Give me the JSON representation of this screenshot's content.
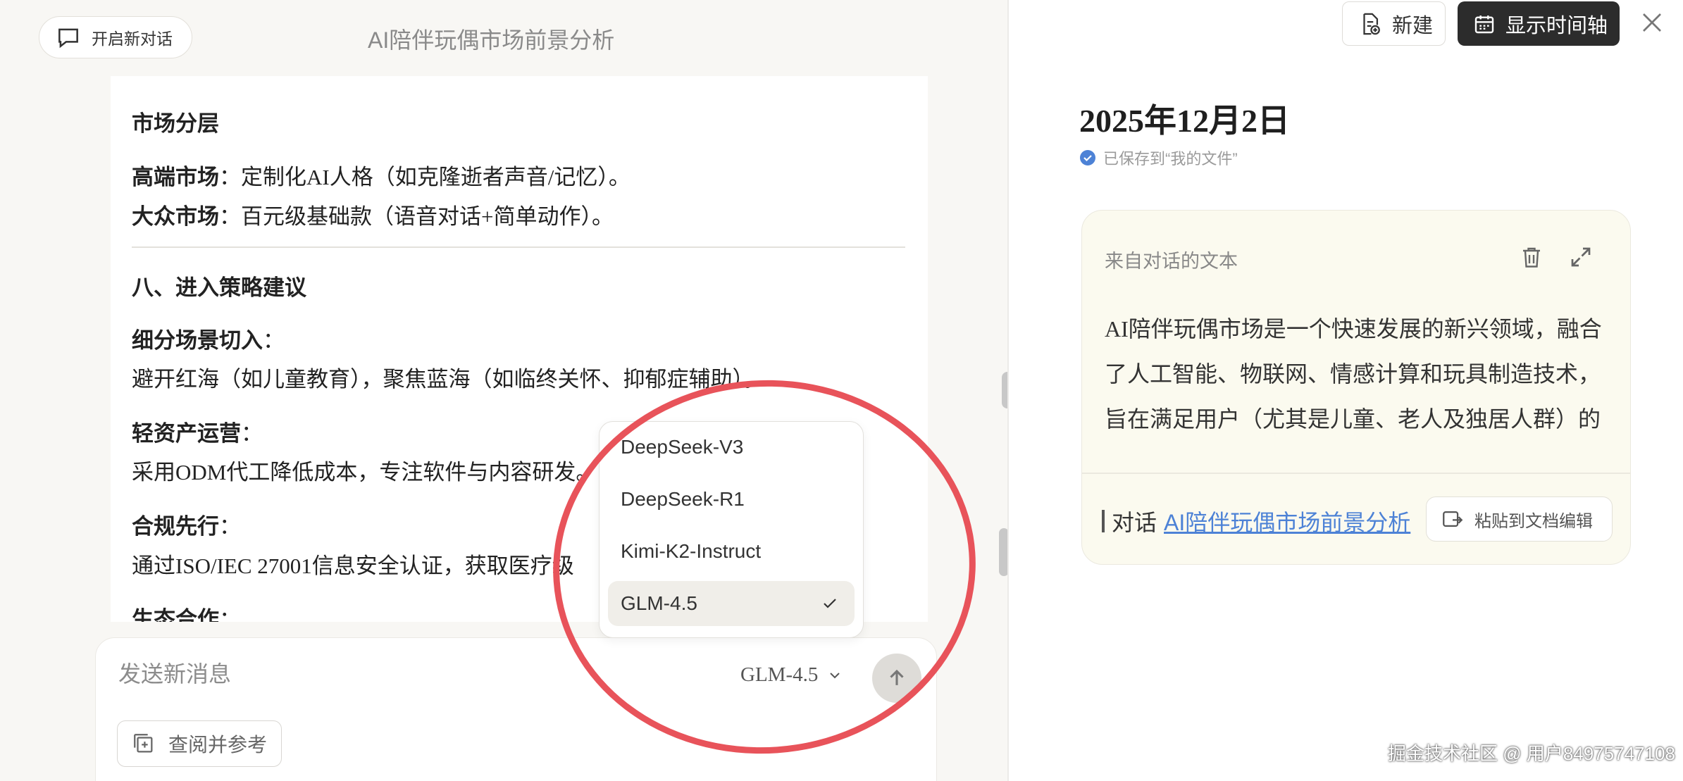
{
  "header": {
    "new_chat_label": "开启新对话",
    "conversation_title": "AI陪伴玩偶市场前景分析"
  },
  "document": {
    "section_market_layers": "市场分层",
    "high_end_label": "高端市场",
    "high_end_text": "：定制化AI人格（如克隆逝者声音/记忆）。",
    "mass_label": "大众市场",
    "mass_text": "：百元级基础款（语音对话+简单动作）。",
    "section_strategy": "八、进入策略建议",
    "item1_title": "细分场景切入",
    "item1_text": "避开红海（如儿童教育），聚焦蓝海（如临终关怀、抑郁症辅助）。",
    "item2_title": "轻资产运营",
    "item2_text": "采用ODM代工降低成本，专注软件与内容研发。",
    "item3_title": "合规先行",
    "item3_text": "通过ISO/IEC 27001信息安全认证，获取医疗级",
    "item4_title": "生态合作",
    "colon": "："
  },
  "composer": {
    "placeholder": "发送新消息",
    "model_label": "GLM-4.5",
    "reference_button": "查阅并参考"
  },
  "model_dropdown": {
    "options": [
      "DeepSeek-V3",
      "DeepSeek-R1",
      "Kimi-K2-Instruct",
      "GLM-4.5"
    ],
    "selected": "GLM-4.5"
  },
  "right_panel": {
    "new_button": "新建",
    "timeline_button": "显示时间轴",
    "date_title": "2025年12月2日",
    "saved_status": "已保存到“我的文件”",
    "card": {
      "source_label": "来自对话的文本",
      "body_line1": "AI陪伴玩偶市场是一个快速发展的新兴领域，融合",
      "body_line2": "了人工智能、物联网、情感计算和玩具制造技术，",
      "body_line3": "旨在满足用户（尤其是儿童、老人及独居人群）的",
      "from_prefix": "对话",
      "from_link": "AI陪伴玩偶市场前景分析",
      "paste_button": "粘贴到文档编辑"
    }
  },
  "watermark": "掘金技术社区 @ 用户84975747108",
  "colors": {
    "annotation_circle": "#e8535a",
    "link": "#4d82d6",
    "dark_button": "#2c2c2c",
    "check_badge": "#4d82d6"
  }
}
